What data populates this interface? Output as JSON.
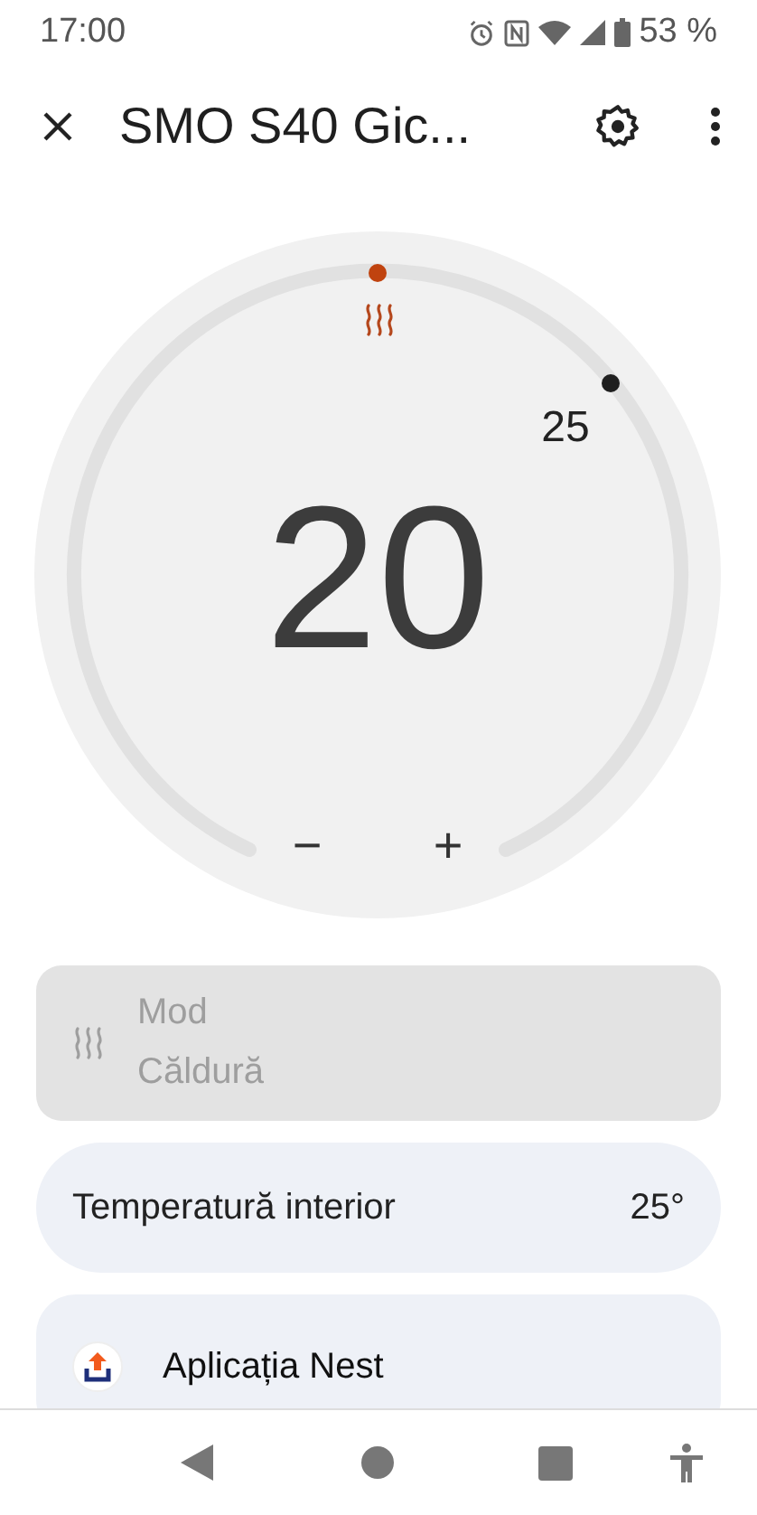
{
  "status_bar": {
    "time": "17:00",
    "battery": "53 %"
  },
  "app_bar": {
    "title": "SMO S40 Gic..."
  },
  "dial": {
    "value": "20",
    "marker_label": "25",
    "decrease": "−",
    "increase": "+"
  },
  "cards": [
    {
      "kind": "mode",
      "label": "Mod",
      "value": "Căldură",
      "disabled": true
    },
    {
      "kind": "reading",
      "label": "Temperatură interior",
      "value": "25°"
    },
    {
      "kind": "app",
      "label": "Aplicația Nest"
    }
  ]
}
